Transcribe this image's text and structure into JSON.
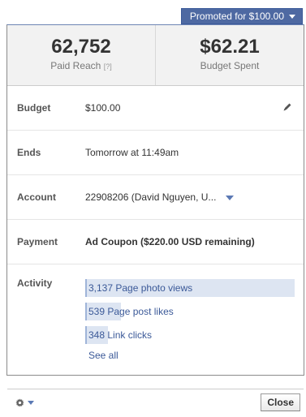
{
  "promote_button": {
    "label": "Promoted for $100.00"
  },
  "stats": {
    "paid_reach": {
      "value": "62,752",
      "label": "Paid Reach",
      "help": "[?]"
    },
    "budget_spent": {
      "value": "$62.21",
      "label": "Budget Spent"
    }
  },
  "details": {
    "budget": {
      "label": "Budget",
      "value": "$100.00"
    },
    "ends": {
      "label": "Ends",
      "value": "Tomorrow at 11:49am"
    },
    "account": {
      "label": "Account",
      "value": "22908206 (David Nguyen, U..."
    },
    "payment": {
      "label": "Payment",
      "value": "Ad Coupon ($220.00 USD remaining)"
    }
  },
  "activity": {
    "label": "Activity",
    "items": [
      {
        "count": "3,137",
        "text": "Page photo views",
        "fill_fraction": 1.0
      },
      {
        "count": "539",
        "text": "Page post likes",
        "fill_fraction": 0.17
      },
      {
        "count": "348",
        "text": "Link clicks",
        "fill_fraction": 0.11
      }
    ],
    "see_all": "See all"
  },
  "footer": {
    "close_label": "Close"
  },
  "colors": {
    "accent": "#3b5998",
    "button_blue": "#4e69a2",
    "activity_fill": "#dde5f2"
  },
  "icons": {
    "edit": "pencil-icon",
    "settings": "gear-icon"
  }
}
